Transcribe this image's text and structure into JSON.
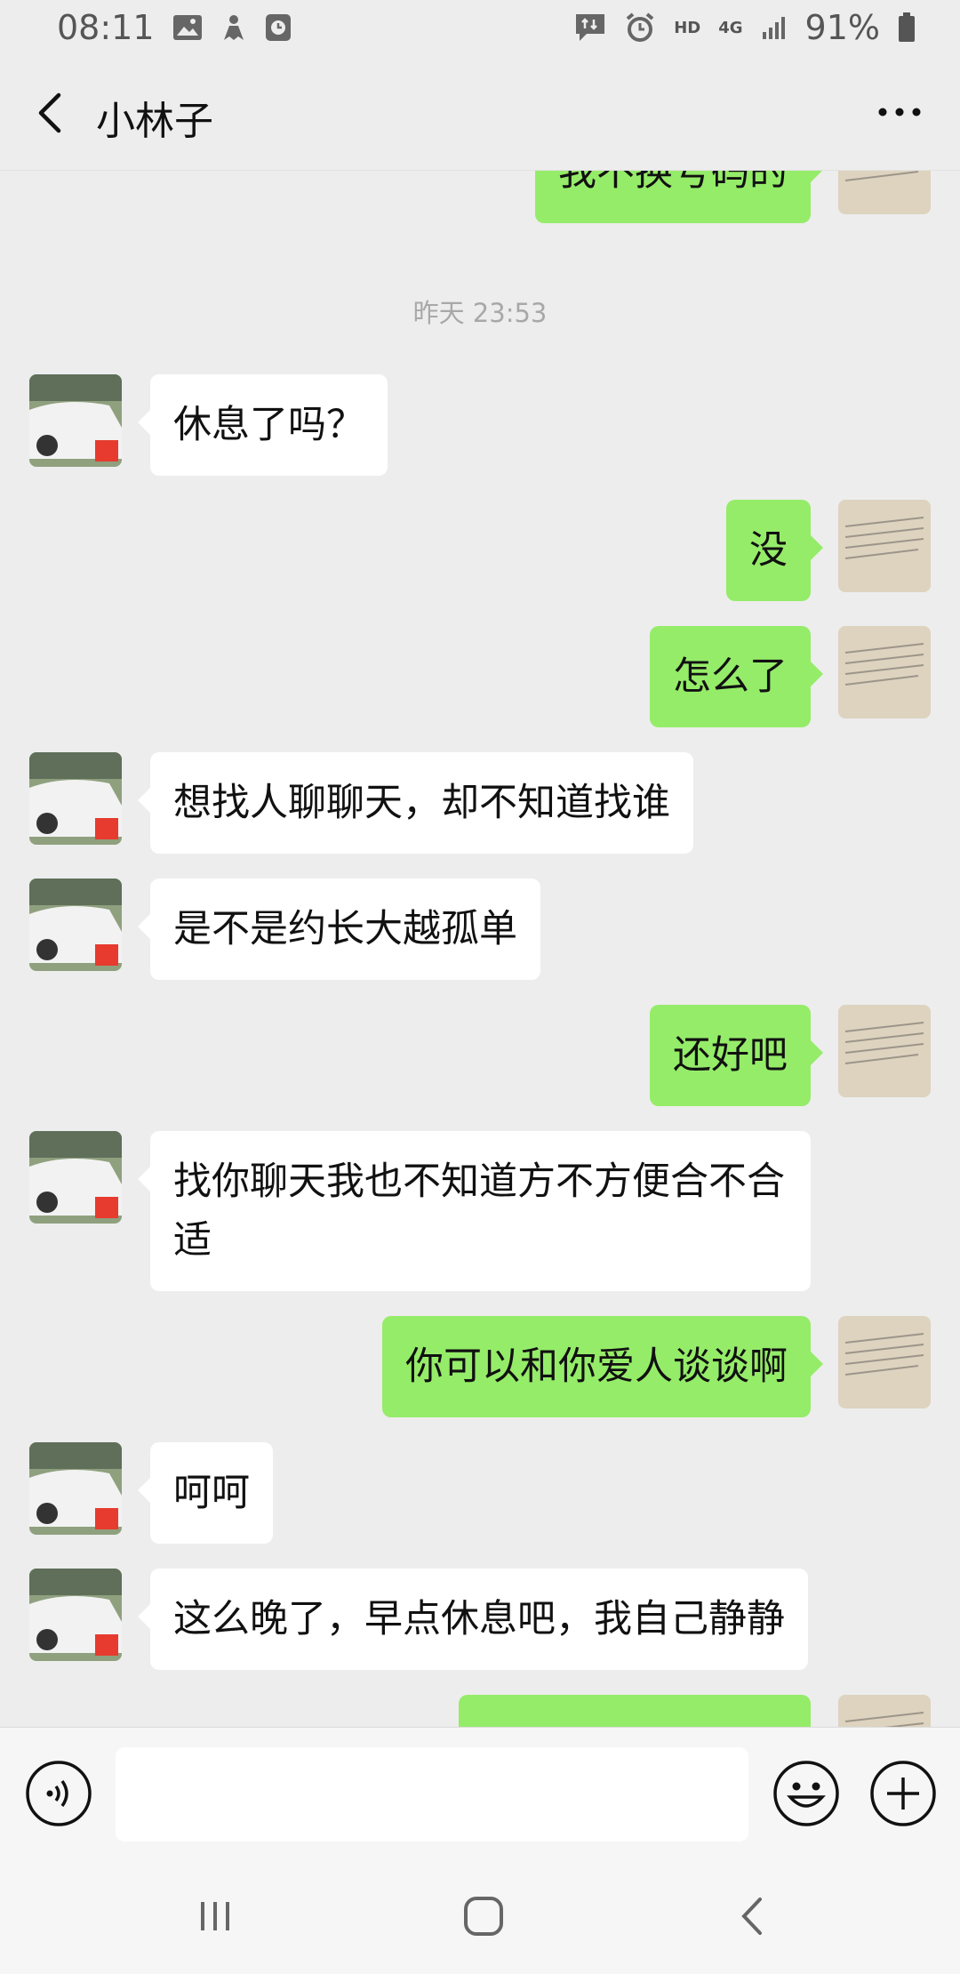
{
  "status_bar": {
    "time": "08:11",
    "network": "HD",
    "signal_gen": "4G",
    "battery": "91%"
  },
  "header": {
    "title": "小林子",
    "more_icon": "more-icon"
  },
  "messages": [
    {
      "side": "out",
      "text": "我不换号码的"
    },
    {
      "type": "time",
      "text": "昨天 23:53"
    },
    {
      "side": "in",
      "text": "休息了吗？"
    },
    {
      "side": "out",
      "text": "没"
    },
    {
      "side": "out",
      "text": "怎么了"
    },
    {
      "side": "in",
      "text": "想找人聊聊天，却不知道找谁"
    },
    {
      "side": "in",
      "text": "是不是约长大越孤单"
    },
    {
      "side": "out",
      "text": "还好吧"
    },
    {
      "side": "in",
      "text": "找你聊天我也不知道方不方便合不合适"
    },
    {
      "side": "out",
      "text": "你可以和你爱人谈谈啊"
    },
    {
      "side": "in",
      "text": "呵呵"
    },
    {
      "side": "in",
      "text": "这么晚了，早点休息吧，我自己静静"
    },
    {
      "side": "out",
      "text": ""
    }
  ],
  "input": {
    "placeholder": ""
  },
  "colors": {
    "background": "#ededed",
    "sent_bubble": "#95ec69",
    "received_bubble": "#ffffff"
  }
}
